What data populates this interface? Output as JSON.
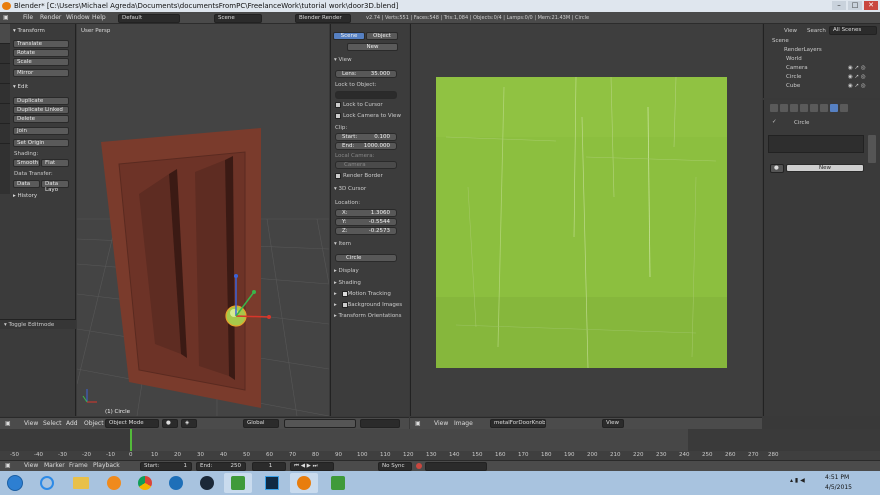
{
  "window": {
    "title": "Blender* [C:\\Users\\Michael Agreda\\Documents\\documentsFromPC\\FreelanceWork\\tutorial work\\door3D.blend]"
  },
  "infobar": {
    "menus": [
      "File",
      "Render",
      "Window",
      "Help"
    ],
    "layout": "Default",
    "scene": "Scene",
    "engine": "Blender Render",
    "stats": "v2.74 | Verts:551 | Faces:548 | Tris:1,084 | Objects:0/4 | Lamps:0/0 | Mem:21.43M | Circle"
  },
  "tools": {
    "tabs": [
      "Tools",
      "Create",
      "Relations",
      "Animation",
      "Physics",
      "Grease Pencil"
    ],
    "transform_header": "Transform",
    "transform": [
      "Translate",
      "Rotate",
      "Scale"
    ],
    "mirror": "Mirror",
    "edit_header": "Edit",
    "edit": [
      "Duplicate",
      "Duplicate Linked",
      "Delete"
    ],
    "join": "Join",
    "set_origin": "Set Origin",
    "shading_label": "Shading:",
    "shading": [
      "Smooth",
      "Flat"
    ],
    "data_transfer_label": "Data Transfer:",
    "data_transfer": [
      "Data",
      "Data Layo"
    ],
    "history_header": "History",
    "toggle_editmode": "Toggle Editmode"
  },
  "viewport": {
    "label": "User Persp",
    "object_label": "(1) Circle"
  },
  "npanel": {
    "tabs": [
      "Scene",
      "Object"
    ],
    "new": "New",
    "view_header": "View",
    "lens_label": "Lens:",
    "lens_value": "35.000",
    "lock_to_object": "Lock to Object:",
    "lock_to_cursor": "Lock to Cursor",
    "lock_camera": "Lock Camera to View",
    "clip_label": "Clip:",
    "clip_start_label": "Start:",
    "clip_start": "0.100",
    "clip_end_label": "End:",
    "clip_end": "1000.000",
    "local_camera": "Local Camera:",
    "camera": "Camera",
    "render_border": "Render Border",
    "cursor_header": "3D Cursor",
    "location_label": "Location:",
    "x_label": "X:",
    "x_value": "1.3060",
    "y_label": "Y:",
    "y_value": "-0.5544",
    "z_label": "Z:",
    "z_value": "-0.2573",
    "item_header": "Item",
    "item_name": "Circle",
    "display": "Display",
    "shading": "Shading",
    "motion_tracking": "Motion Tracking",
    "background_images": "Background Images",
    "transform_orientations": "Transform Orientations"
  },
  "header3d": {
    "menus": [
      "View",
      "Select",
      "Add",
      "Object"
    ],
    "mode": "Object Mode",
    "orientation": "Global"
  },
  "imageeditor": {
    "menus": [
      "View",
      "Image"
    ],
    "image_name": "metalForDoorKnob",
    "view": "View"
  },
  "outliner": {
    "menus": [
      "View",
      "Search"
    ],
    "filter": "All Scenes",
    "items": [
      "Scene",
      "RenderLayers",
      "World",
      "Camera",
      "Circle",
      "Cube"
    ]
  },
  "props": {
    "object": "Circle",
    "new": "New"
  },
  "timeline": {
    "ruler": [
      "-50",
      "-40",
      "-30",
      "-20",
      "-10",
      "0",
      "10",
      "20",
      "30",
      "40",
      "50",
      "60",
      "70",
      "80",
      "90",
      "100",
      "110",
      "120",
      "130",
      "140",
      "150",
      "160",
      "170",
      "180",
      "190",
      "200",
      "210",
      "220",
      "230",
      "240",
      "250",
      "260",
      "270",
      "280"
    ],
    "menus": [
      "View",
      "Marker",
      "Frame",
      "Playback"
    ],
    "start_label": "Start:",
    "start": "1",
    "end_label": "End:",
    "end": "250",
    "current": "1",
    "sync": "No Sync"
  },
  "taskbar": {
    "time": "4:51 PM",
    "date": "4/5/2015"
  },
  "colors": {
    "texture": "#8cbf3f",
    "door": "#7a3b2c",
    "accent": "#5680c2"
  }
}
